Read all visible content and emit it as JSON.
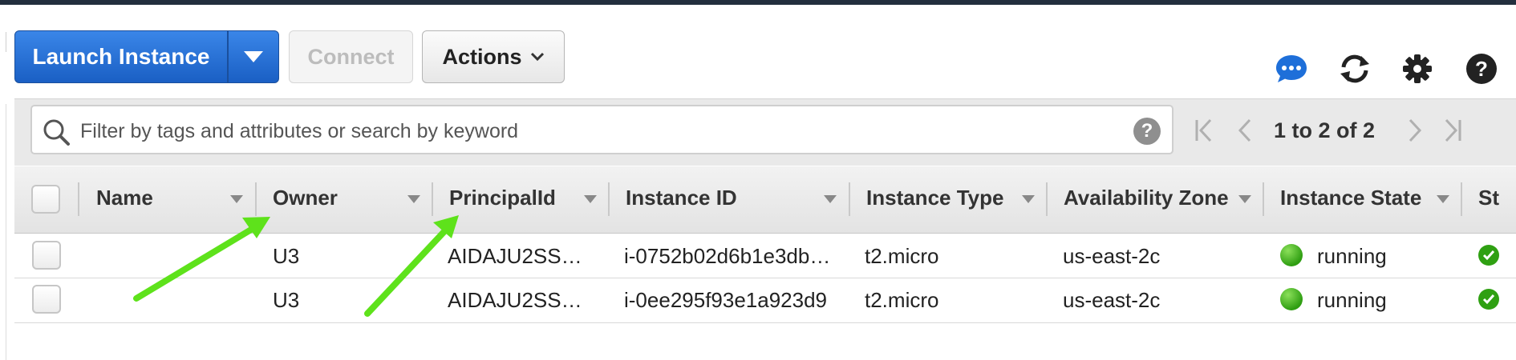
{
  "toolbar": {
    "launch_label": "Launch Instance",
    "connect_label": "Connect",
    "actions_label": "Actions"
  },
  "icons": {
    "chat": "chat-bubble-icon",
    "refresh": "refresh-icon",
    "settings": "gear-icon",
    "help": "help-icon"
  },
  "filter": {
    "placeholder": "Filter by tags and attributes or search by keyword",
    "help_glyph": "?"
  },
  "pager": {
    "text": "1 to 2 of 2"
  },
  "table": {
    "columns": [
      "Name",
      "Owner",
      "PrincipalId",
      "Instance ID",
      "Instance Type",
      "Availability Zone",
      "Instance State",
      "St"
    ],
    "rows": [
      {
        "name": "",
        "owner": "U3",
        "principal": "AIDAJU2SS…",
        "instance_id": "i-0752b02d6b1e3db…",
        "type": "t2.micro",
        "zone": "us-east-2c",
        "state": "running"
      },
      {
        "name": "",
        "owner": "U3",
        "principal": "AIDAJU2SS…",
        "instance_id": "i-0ee295f93e1a923d9",
        "type": "t2.micro",
        "zone": "us-east-2c",
        "state": "running"
      }
    ]
  },
  "colors": {
    "primary": "#1a5fc4",
    "running": "#3cb521",
    "arrow": "#5ee21b"
  }
}
